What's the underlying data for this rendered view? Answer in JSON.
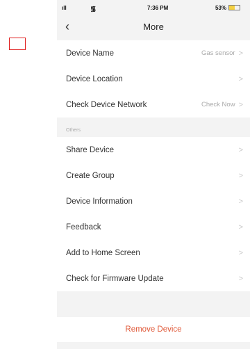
{
  "status_bar": {
    "signal_icon": "signal-bars-icon",
    "wifi_icon": "wifi-icon",
    "time": "7:36 PM",
    "battery_percent": "53%",
    "battery_level": 0.53,
    "battery_color": "#f5d142"
  },
  "header": {
    "back_icon": "chevron-left-icon",
    "title": "More"
  },
  "settings_top": [
    {
      "label": "Device Name",
      "value": "Gas sensor"
    },
    {
      "label": "Device Location",
      "value": ""
    },
    {
      "label": "Check Device Network",
      "value": "Check Now"
    }
  ],
  "others_section": {
    "header": "Others",
    "items": [
      {
        "label": "Share Device"
      },
      {
        "label": "Create Group"
      },
      {
        "label": "Device Information"
      },
      {
        "label": "Feedback"
      },
      {
        "label": "Add to Home Screen"
      },
      {
        "label": "Check for Firmware Update"
      }
    ]
  },
  "remove_button": {
    "label": "Remove Device",
    "color": "#e05a3a"
  },
  "chevron_glyph": ">",
  "highlight_box_color": "#e02020"
}
